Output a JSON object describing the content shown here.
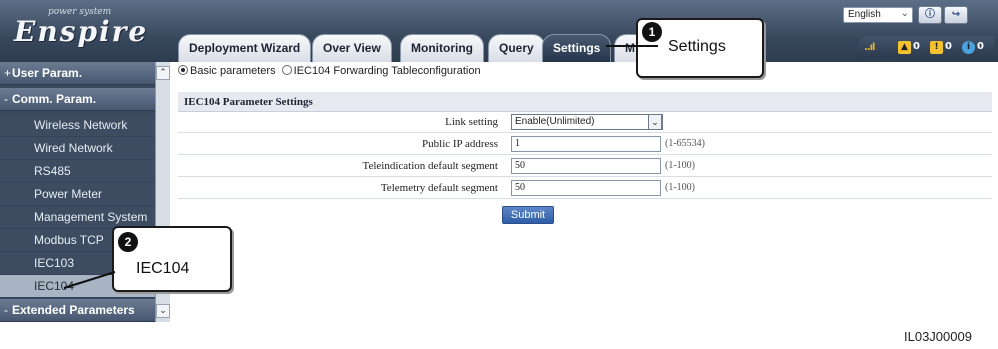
{
  "header": {
    "logo_tagline": "power system",
    "logo_brand": "Enspire",
    "language": "English",
    "help_icon": "help-icon",
    "logout_icon": "logout-icon",
    "tabs": [
      {
        "label": "Deployment Wizard",
        "active": false
      },
      {
        "label": "Over View",
        "active": false
      },
      {
        "label": "Monitoring",
        "active": false
      },
      {
        "label": "Query",
        "active": false
      },
      {
        "label": "Settings",
        "active": true
      },
      {
        "label": "M",
        "active": false
      }
    ],
    "status": {
      "signal_icon": "signal-icon",
      "alarms": [
        {
          "icon": "warning-icon",
          "count": "0",
          "color": "#f2c230"
        },
        {
          "icon": "minor-alarm-icon",
          "count": "0",
          "color": "#f2c230"
        },
        {
          "icon": "info-icon",
          "count": "0",
          "color": "#4aa3e0"
        }
      ]
    }
  },
  "sidebar": {
    "items": [
      {
        "label": "User Param.",
        "type": "group",
        "marker": "+"
      },
      {
        "label": "Comm. Param.",
        "type": "group",
        "marker": "-"
      },
      {
        "label": "Wireless Network",
        "type": "sub"
      },
      {
        "label": "Wired Network",
        "type": "sub"
      },
      {
        "label": "RS485",
        "type": "sub"
      },
      {
        "label": "Power Meter",
        "type": "sub"
      },
      {
        "label": "Management System",
        "type": "sub"
      },
      {
        "label": "Modbus TCP",
        "type": "sub"
      },
      {
        "label": "IEC103",
        "type": "sub"
      },
      {
        "label": "IEC104",
        "type": "sub",
        "selected": true
      },
      {
        "label": "Extended Parameters",
        "type": "group",
        "marker": "-"
      }
    ]
  },
  "content": {
    "radio_basic": "Basic parameters",
    "radio_forwarding": "IEC104 Forwarding Tableconfiguration",
    "section_title": "IEC104 Parameter Settings",
    "fields": [
      {
        "label": "Link setting",
        "value": "Enable(Unlimited)",
        "kind": "select",
        "range": ""
      },
      {
        "label": "Public IP address",
        "value": "1",
        "kind": "input",
        "range": "(1-65534)"
      },
      {
        "label": "Teleindication default segment",
        "value": "50",
        "kind": "input",
        "range": "(1-100)"
      },
      {
        "label": "Telemetry default segment",
        "value": "50",
        "kind": "input",
        "range": "(1-100)"
      }
    ],
    "submit_label": "Submit"
  },
  "callouts": [
    {
      "number": "1",
      "text": "Settings"
    },
    {
      "number": "2",
      "text": "IEC104"
    }
  ],
  "figure_id": "IL03J00009"
}
